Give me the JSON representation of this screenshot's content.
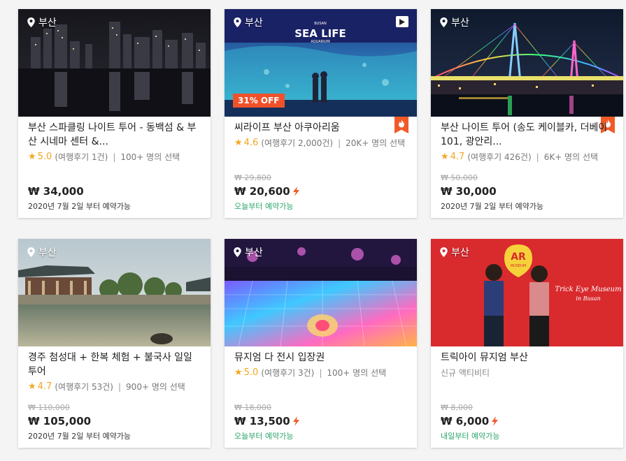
{
  "cards": [
    {
      "location": "부산",
      "title": "부산 스파클링 나이트 투어 - 동백섬 & 부산 시네마 센터 &...",
      "rating": "5.0",
      "reviews": "(여행후기 1건)",
      "booked": "100+ 명의 선택",
      "original_price": "",
      "price": "₩ 34,000",
      "availability": "2020년 7월 2일 부터 예약가능"
    },
    {
      "location": "부산",
      "discount_badge": "31% OFF",
      "image_text": "SEA LIFE",
      "image_text_top": "BUSAN",
      "image_text_bottom": "AQUARIUM",
      "title": "씨라이프 부산 아쿠아리움",
      "rating": "4.6",
      "reviews": "(여행후기 2,000건)",
      "booked": "20K+ 명의 선택",
      "original_price": "₩ 29,800",
      "price": "₩ 20,600",
      "availability": "오늘부터 예약가능"
    },
    {
      "location": "부산",
      "title": "부산 나이트 투어 (송도 케이블카, 더베이 101, 광안리...",
      "rating": "4.7",
      "reviews": "(여행후기 426건)",
      "booked": "6K+ 명의 선택",
      "original_price": "₩ 50,000",
      "price": "₩ 30,000",
      "availability": "2020년 7월 2일 부터 예약가능"
    },
    {
      "location": "부산",
      "title": "경주 첨성대 + 한복 체험 + 불국사 일일 투어",
      "rating": "4.7",
      "reviews": "(여행후기 53건)",
      "booked": "900+ 명의 선택",
      "original_price": "₩ 110,000",
      "price": "₩ 105,000",
      "availability": "2020년 7월 2일 부터 예약가능"
    },
    {
      "location": "부산",
      "title": "뮤지엄 다 전시 입장권",
      "rating": "5.0",
      "reviews": "(여행후기 3건)",
      "booked": "100+ 명의 선택",
      "original_price": "₩ 18,000",
      "price": "₩ 13,500",
      "availability": "오늘부터 예약가능"
    },
    {
      "location": "부산",
      "image_badge_top": "AR",
      "image_badge_bottom": "MUSEUM",
      "image_script": "Trick Eye Museum",
      "image_script_sub": "in Busan",
      "title": "트릭아이 뮤지엄 부산",
      "subtitle": "신규 액티비티",
      "original_price": "₩ 8,000",
      "price": "₩ 6,000",
      "availability": "내일부터 예약가능"
    }
  ],
  "colors": {
    "accent": "#f05a28",
    "star": "#f3a721",
    "available_green": "#2ba56b"
  },
  "icons": [
    "location-pin-icon",
    "play-icon",
    "flame-icon",
    "star-icon"
  ]
}
